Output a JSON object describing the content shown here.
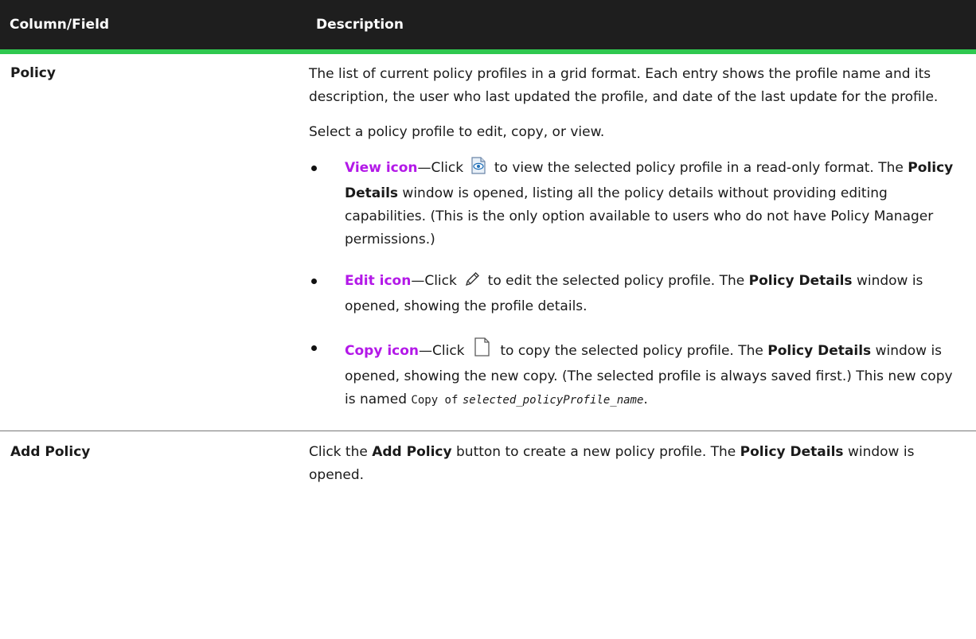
{
  "header": {
    "col1": "Column/Field",
    "col2": "Description"
  },
  "rows": {
    "policy": {
      "field": "Policy",
      "intro": "The list of current policy profiles in a grid format. Each entry shows the profile name and its description, the user who last updated the profile, and date of the last update for the profile.",
      "select_text": "Select a policy profile to edit, copy, or view.",
      "view": {
        "link": "View icon",
        "pre": "—Click",
        "post": "to view the selected policy profile in a read-only format. The",
        "bold": "Policy Details",
        "rest": "window is opened, listing all the policy details without providing editing capabilities. (This is the only option available to users who do not have Policy Manager permissions.)",
        "icon": "view-icon"
      },
      "edit": {
        "link": "Edit icon",
        "pre": "—Click",
        "post": "to edit the selected policy profile. The",
        "bold": "Policy Details",
        "rest": "window is opened, showing the profile details.",
        "icon": "pencil-icon"
      },
      "copy": {
        "link": "Copy icon",
        "pre": "—Click",
        "post": "to copy the selected policy profile. The",
        "bold": "Policy Details",
        "rest": "window is opened, showing the new copy. (The selected profile is always saved first.) This new copy is named",
        "code": "Copy of",
        "code_italic": "selected_policyProfile_name",
        "end": ".",
        "icon": "copy-icon"
      }
    },
    "add_policy": {
      "field": "Add Policy",
      "pre": "Click the",
      "bold1": "Add Policy",
      "mid": "button to create a new policy profile. The",
      "bold2": "Policy Details",
      "post": "window is opened."
    }
  },
  "colors": {
    "header_bg": "#1e1e1e",
    "header_accent": "#2fc84f",
    "link": "#b318e8"
  }
}
